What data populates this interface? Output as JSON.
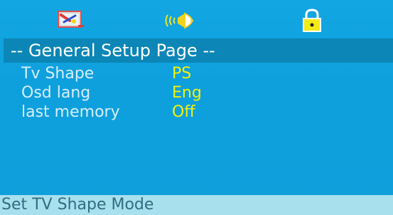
{
  "header": {
    "icons": [
      "general-setup-icon",
      "audio-speaker-icon",
      "lock-icon"
    ]
  },
  "title": "-- General Setup Page --",
  "settings": [
    {
      "label": "Tv Shape",
      "value": "PS"
    },
    {
      "label": "Osd lang",
      "value": "Eng"
    },
    {
      "label": "last memory",
      "value": "Off"
    }
  ],
  "status": "Set TV Shape Mode",
  "colors": {
    "background": "#0fa2df",
    "title_bar": "#0b86b6",
    "value_text": "#f2f20a",
    "status_bar": "#a9e0ee"
  }
}
